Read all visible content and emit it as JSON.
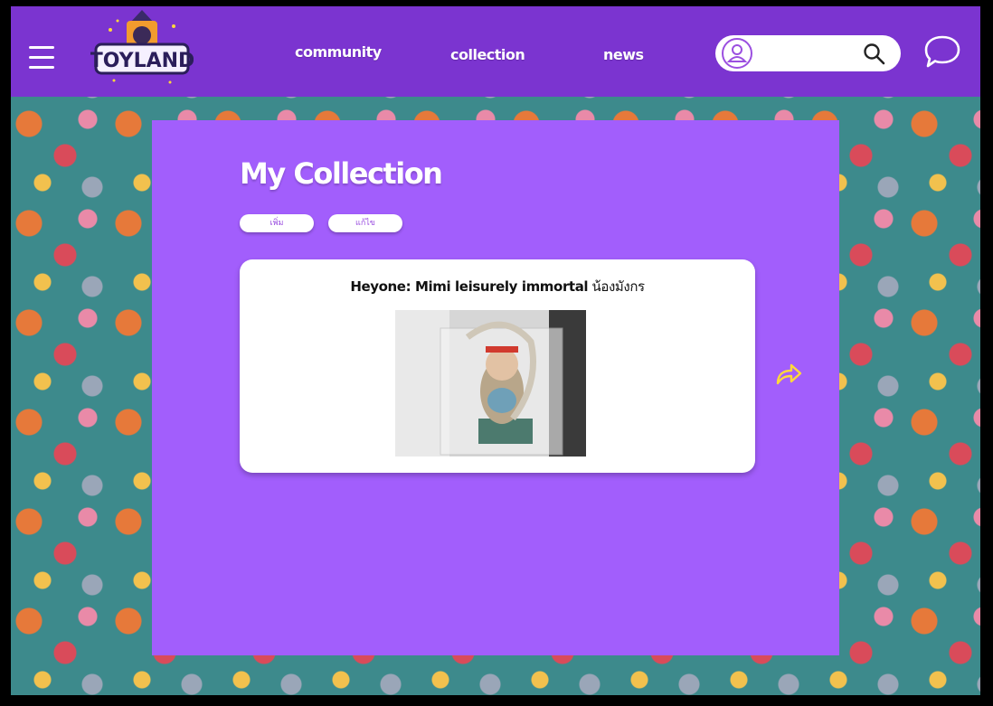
{
  "header": {
    "logo_text": "TOYLAND",
    "nav": {
      "community": "community",
      "collection": "collection",
      "news": "news"
    },
    "search": {
      "placeholder": ""
    },
    "icons": {
      "menu": "hamburger-menu-icon",
      "user": "user-icon",
      "search": "search-icon",
      "chat": "chat-bubble-icon"
    }
  },
  "main": {
    "title": "My Collection",
    "buttons": {
      "add": "เพิ่ม",
      "edit": "แก้ไข"
    },
    "card": {
      "title_bold": "Heyone: Mimi leisurely immortal",
      "title_thai": "น้องมังกร"
    },
    "share_icon": "share-arrow-icon"
  },
  "colors": {
    "navbar": "#7b34d0",
    "panel": "#a25efc",
    "accent": "#9b4fe0",
    "share": "#ffd93b"
  }
}
